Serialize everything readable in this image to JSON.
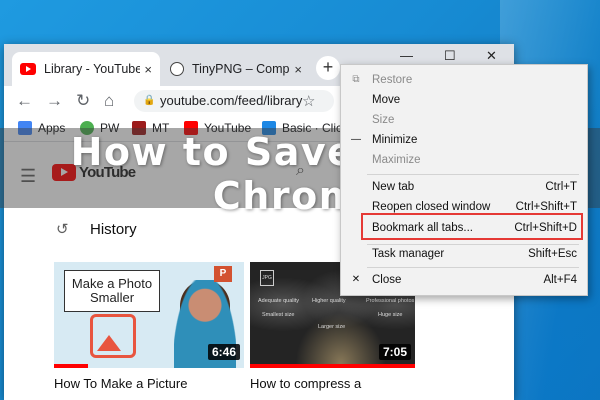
{
  "headline": "How to Save Tabs in Chrome",
  "browser": {
    "tabs": [
      {
        "title": "Library - YouTube",
        "close": "×"
      },
      {
        "title": "TinyPNG – Compress",
        "close": "×"
      }
    ],
    "new_tab_symbol": "+",
    "window_buttons": {
      "minimize": "—",
      "maximize": "☐",
      "close": "✕"
    },
    "toolbar": {
      "back": "←",
      "forward": "→",
      "reload": "↻",
      "home": "⌂",
      "url": "youtube.com/feed/library",
      "star": "☆"
    },
    "bookmarks": [
      {
        "label": "Apps",
        "color": "#4285f4"
      },
      {
        "label": "PW",
        "color": "#4caf50"
      },
      {
        "label": "MT",
        "color": "#9c1c1c"
      },
      {
        "label": "YouTube",
        "color": "#ff0000"
      },
      {
        "label": "Basic · Click",
        "color": "#1e88e5"
      }
    ]
  },
  "youtube": {
    "logo_text": "YouTube",
    "section_title": "History",
    "videos": [
      {
        "card_text": "Make a Photo Smaller",
        "duration": "6:46",
        "title": "How To Make a Picture",
        "progress": 0.18,
        "badge": "P"
      },
      {
        "duration": "7:05",
        "title": "How to compress a",
        "progress": 1.0,
        "labels": [
          "JPG",
          "Adequate quality",
          "Smallest size",
          "Higher quality",
          "Larger size",
          "Professional photos",
          "Huge size"
        ]
      }
    ]
  },
  "system_menu": {
    "items": [
      {
        "glyph": "⧉",
        "label": "Restore",
        "accel": "",
        "disabled": true
      },
      {
        "glyph": "",
        "label": "Move",
        "accel": "",
        "disabled": false
      },
      {
        "glyph": "",
        "label": "Size",
        "accel": "",
        "disabled": true
      },
      {
        "glyph": "—",
        "label": "Minimize",
        "accel": "",
        "disabled": false
      },
      {
        "glyph": "",
        "label": "Maximize",
        "accel": "",
        "disabled": true
      },
      {
        "glyph": "",
        "label": "New tab",
        "accel": "Ctrl+T",
        "disabled": false
      },
      {
        "glyph": "",
        "label": "Reopen closed window",
        "accel": "Ctrl+Shift+T",
        "disabled": false
      },
      {
        "glyph": "",
        "label": "Bookmark all tabs...",
        "accel": "Ctrl+Shift+D",
        "disabled": false
      },
      {
        "glyph": "",
        "label": "Task manager",
        "accel": "Shift+Esc",
        "disabled": false
      },
      {
        "glyph": "✕",
        "label": "Close",
        "accel": "Alt+F4",
        "disabled": false
      }
    ],
    "highlighted_item": "Bookmark all tabs..."
  }
}
